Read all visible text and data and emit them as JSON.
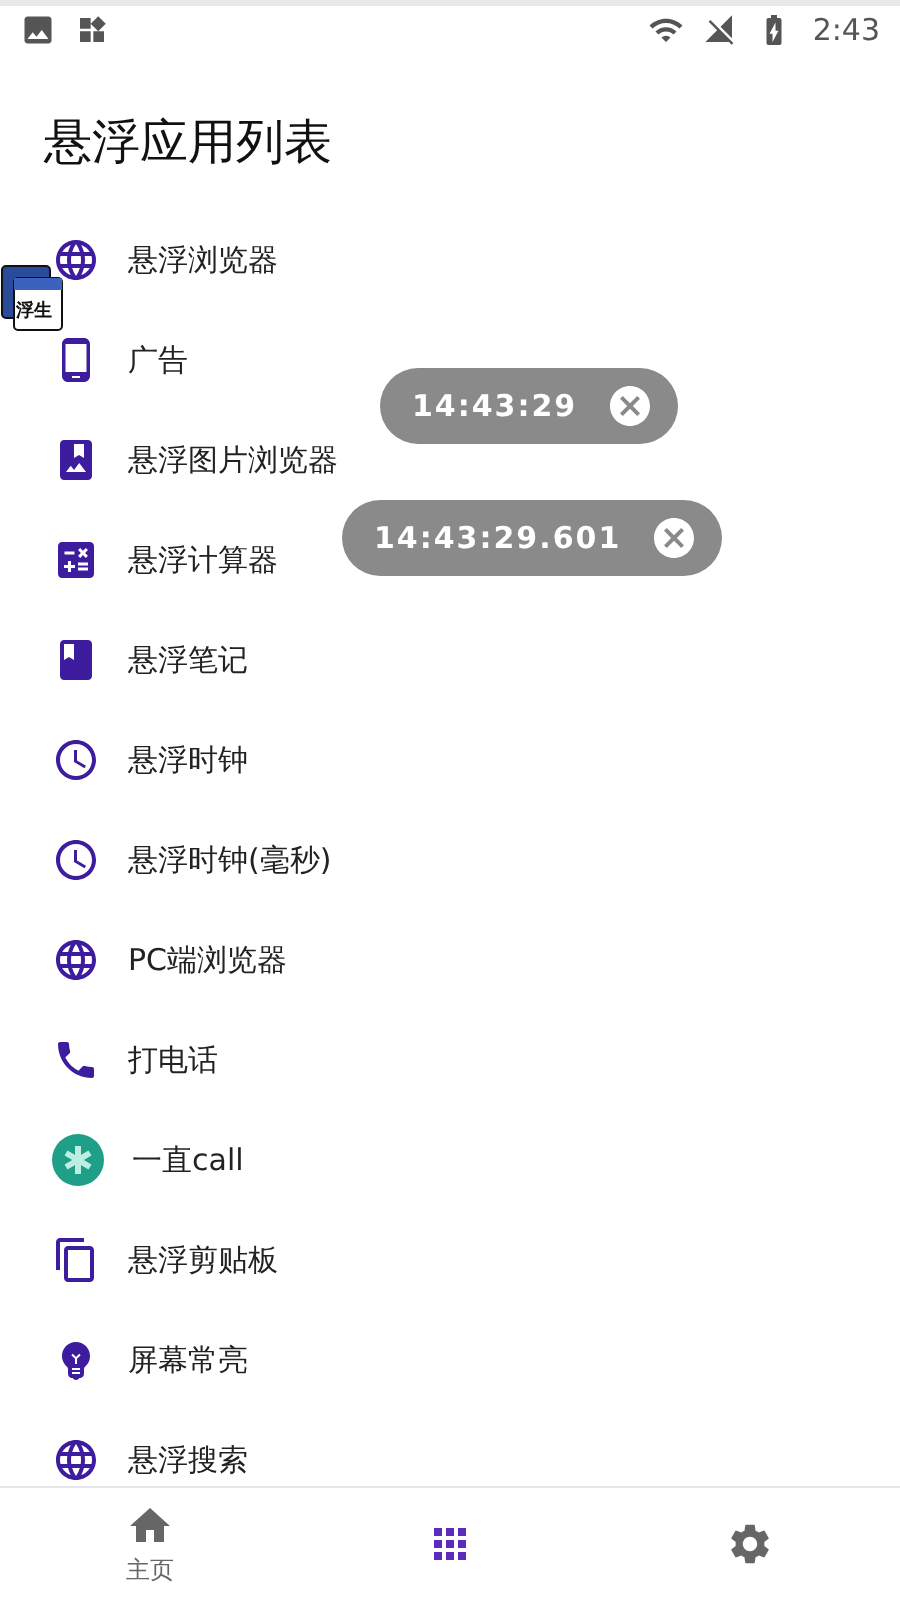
{
  "status_bar": {
    "time": "2:43"
  },
  "title": "悬浮应用列表",
  "apps": [
    {
      "label": "悬浮浏览器"
    },
    {
      "label": "广告"
    },
    {
      "label": "悬浮图片浏览器"
    },
    {
      "label": "悬浮计算器"
    },
    {
      "label": "悬浮笔记"
    },
    {
      "label": "悬浮时钟"
    },
    {
      "label": "悬浮时钟(毫秒)"
    },
    {
      "label": "PC端浏览器"
    },
    {
      "label": "打电话"
    },
    {
      "label": "一直call"
    },
    {
      "label": "悬浮剪贴板"
    },
    {
      "label": "屏幕常亮"
    },
    {
      "label": "悬浮搜索"
    }
  ],
  "floating_logo": {
    "text": "浮生"
  },
  "floating_clocks": [
    {
      "time": "14:43:29"
    },
    {
      "time": "14:43:29.601"
    }
  ],
  "bottom_nav": [
    {
      "label": "主页",
      "selected": false
    },
    {
      "selected": true
    },
    {
      "selected": false
    }
  ]
}
